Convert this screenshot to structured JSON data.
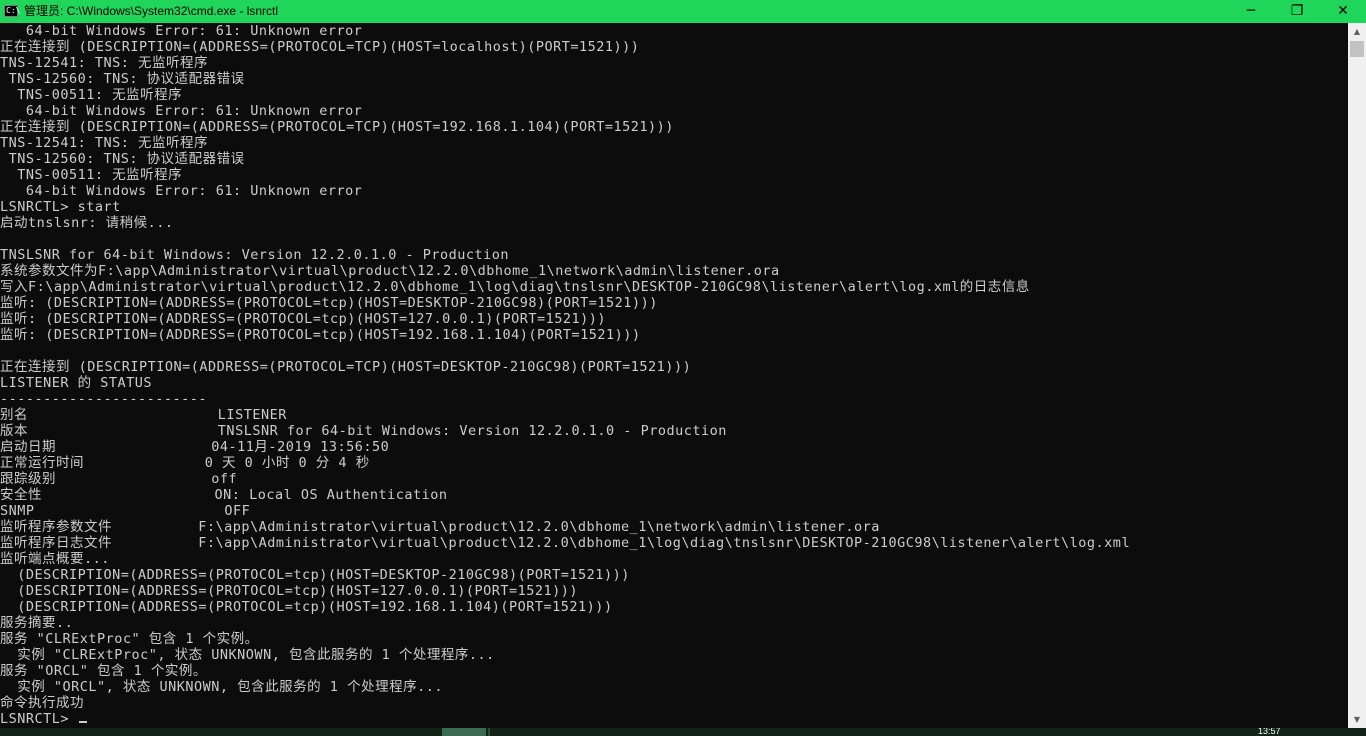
{
  "window": {
    "title": "管理员: C:\\Windows\\System32\\cmd.exe - lsnrctl",
    "icon": "cmd-icon",
    "icon_text": "C:\\",
    "minimize_glyph": "─",
    "restore_glyph": "❐",
    "close_glyph": "✕"
  },
  "console": {
    "lines": [
      "   64-bit Windows Error: 61: Unknown error",
      "正在连接到 (DESCRIPTION=(ADDRESS=(PROTOCOL=TCP)(HOST=localhost)(PORT=1521)))",
      "TNS-12541: TNS: 无监听程序",
      " TNS-12560: TNS: 协议适配器错误",
      "  TNS-00511: 无监听程序",
      "   64-bit Windows Error: 61: Unknown error",
      "正在连接到 (DESCRIPTION=(ADDRESS=(PROTOCOL=TCP)(HOST=192.168.1.104)(PORT=1521)))",
      "TNS-12541: TNS: 无监听程序",
      " TNS-12560: TNS: 协议适配器错误",
      "  TNS-00511: 无监听程序",
      "   64-bit Windows Error: 61: Unknown error",
      "LSNRCTL> start",
      "启动tnslsnr: 请稍候...",
      "",
      "TNSLSNR for 64-bit Windows: Version 12.2.0.1.0 - Production",
      "系统参数文件为F:\\app\\Administrator\\virtual\\product\\12.2.0\\dbhome_1\\network\\admin\\listener.ora",
      "写入F:\\app\\Administrator\\virtual\\product\\12.2.0\\dbhome_1\\log\\diag\\tnslsnr\\DESKTOP-210GC98\\listener\\alert\\log.xml的日志信息",
      "监听: (DESCRIPTION=(ADDRESS=(PROTOCOL=tcp)(HOST=DESKTOP-210GC98)(PORT=1521)))",
      "监听: (DESCRIPTION=(ADDRESS=(PROTOCOL=tcp)(HOST=127.0.0.1)(PORT=1521)))",
      "监听: (DESCRIPTION=(ADDRESS=(PROTOCOL=tcp)(HOST=192.168.1.104)(PORT=1521)))",
      "",
      "正在连接到 (DESCRIPTION=(ADDRESS=(PROTOCOL=TCP)(HOST=DESKTOP-210GC98)(PORT=1521)))",
      "LISTENER 的 STATUS",
      "------------------------",
      "别名                      LISTENER",
      "版本                      TNSLSNR for 64-bit Windows: Version 12.2.0.1.0 - Production",
      "启动日期                  04-11月-2019 13:56:50",
      "正常运行时间              0 天 0 小时 0 分 4 秒",
      "跟踪级别                  off",
      "安全性                    ON: Local OS Authentication",
      "SNMP                      OFF",
      "监听程序参数文件          F:\\app\\Administrator\\virtual\\product\\12.2.0\\dbhome_1\\network\\admin\\listener.ora",
      "监听程序日志文件          F:\\app\\Administrator\\virtual\\product\\12.2.0\\dbhome_1\\log\\diag\\tnslsnr\\DESKTOP-210GC98\\listener\\alert\\log.xml",
      "监听端点概要...",
      "  (DESCRIPTION=(ADDRESS=(PROTOCOL=tcp)(HOST=DESKTOP-210GC98)(PORT=1521)))",
      "  (DESCRIPTION=(ADDRESS=(PROTOCOL=tcp)(HOST=127.0.0.1)(PORT=1521)))",
      "  (DESCRIPTION=(ADDRESS=(PROTOCOL=tcp)(HOST=192.168.1.104)(PORT=1521)))",
      "服务摘要..",
      "服务 \"CLRExtProc\" 包含 1 个实例。",
      "  实例 \"CLRExtProc\", 状态 UNKNOWN, 包含此服务的 1 个处理程序...",
      "服务 \"ORCL\" 包含 1 个实例。",
      "  实例 \"ORCL\", 状态 UNKNOWN, 包含此服务的 1 个处理程序...",
      "命令执行成功"
    ],
    "prompt": "LSNRCTL> "
  },
  "scrollbar": {
    "up_glyph": "▲",
    "down_glyph": "▼"
  },
  "taskbar": {
    "clock": "13:57"
  },
  "colors": {
    "titlebar": "#1fd65a",
    "console_bg": "#0c0c0c",
    "console_fg": "#cccccc"
  }
}
